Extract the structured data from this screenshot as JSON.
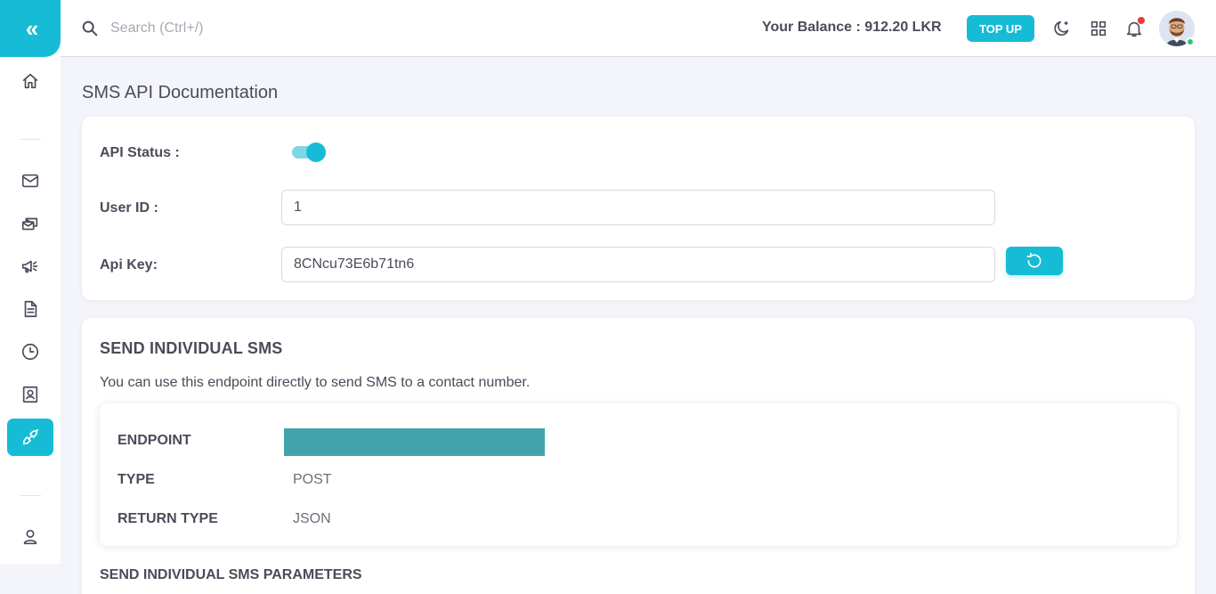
{
  "sidebar": {
    "collapse_icon": "double-chevron-left-icon",
    "items": [
      {
        "icon": "home-icon",
        "active": false
      },
      {
        "icon": "mail-icon",
        "active": false
      },
      {
        "icon": "bulk-mail-icon",
        "active": false
      },
      {
        "icon": "megaphone-icon",
        "active": false
      },
      {
        "icon": "document-icon",
        "active": false
      },
      {
        "icon": "clock-icon",
        "active": false
      },
      {
        "icon": "contact-card-icon",
        "active": false
      },
      {
        "icon": "plug-icon",
        "active": true
      },
      {
        "icon": "user-icon",
        "active": false
      }
    ],
    "accent_color": "#16bcd6"
  },
  "header": {
    "search_placeholder": "Search (Ctrl+/)",
    "balance_text": "Your Balance : 912.20 LKR",
    "topup_label": "TOP UP",
    "icons": [
      "moon-icon",
      "grid-icon",
      "bell-icon",
      "avatar"
    ],
    "notification_dot_color": "#ea3b3b",
    "online_status_color": "#28c76f"
  },
  "page": {
    "title": "SMS API Documentation"
  },
  "api_settings": {
    "status_label": "API Status :",
    "status_enabled": true,
    "user_id_label": "User ID :",
    "user_id_value": "1",
    "api_key_label": "Api Key:",
    "api_key_value": "8CNcu73E6b71tn6",
    "regenerate_icon": "refresh-icon"
  },
  "send_individual": {
    "title": "SEND INDIVIDUAL SMS",
    "description": "You can use this endpoint directly to send SMS to a contact number.",
    "endpoint_label": "ENDPOINT",
    "endpoint_redacted_color": "#42a3ab",
    "type_label": "TYPE",
    "type_value": "POST",
    "return_type_label": "RETURN TYPE",
    "return_type_value": "JSON",
    "params_title": "SEND INDIVIDUAL SMS PARAMETERS"
  }
}
